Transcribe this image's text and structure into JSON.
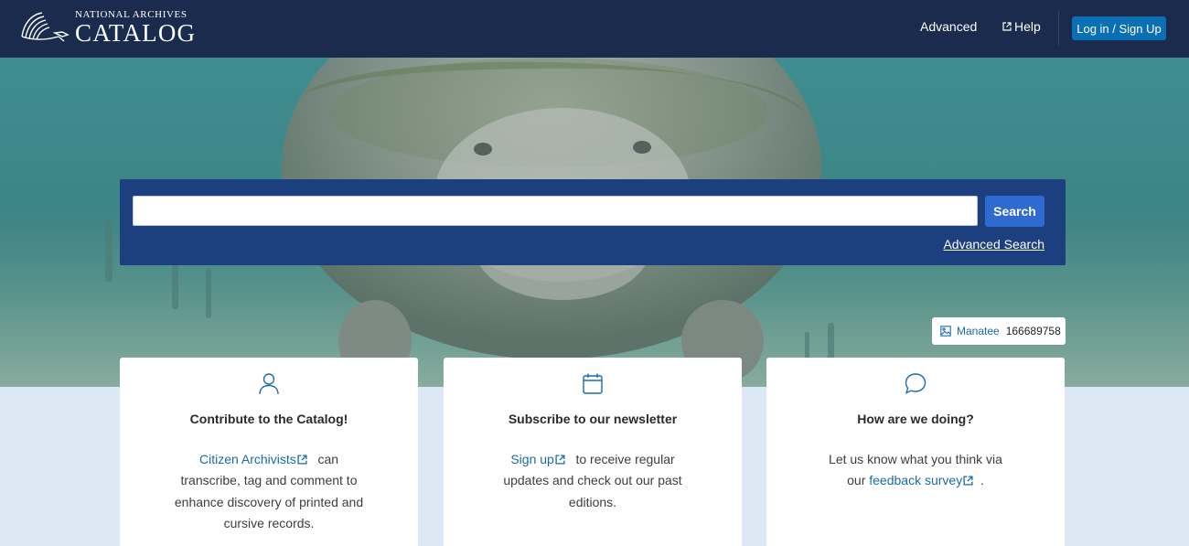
{
  "header": {
    "logo_top": "NATIONAL ARCHIVES",
    "logo_main": "CATALOG",
    "nav_advanced": "Advanced",
    "nav_help": "Help",
    "login_label": "Log in / Sign Up"
  },
  "search": {
    "value": "",
    "placeholder": "",
    "button_label": "Search",
    "advanced_link": "Advanced Search"
  },
  "photo_credit": {
    "title": "Manatee",
    "id": "166689758"
  },
  "cards": [
    {
      "icon": "user-icon",
      "title": "Contribute to the Catalog!",
      "link_text": "Citizen Archivists",
      "line1_after": "can",
      "line2": "transcribe, tag and comment to",
      "line3": "enhance discovery of printed and",
      "line4": "cursive records."
    },
    {
      "icon": "calendar-icon",
      "title": "Subscribe to our newsletter",
      "link_text": "Sign up",
      "line1_after": "to receive regular",
      "line2": "updates and check out our past",
      "line3": "editions."
    },
    {
      "icon": "chat-bubble-icon",
      "title": "How are we doing?",
      "line1": "Let us know what you think via",
      "line2_before": "our",
      "link_text": "feedback survey",
      "line2_after": "."
    }
  ],
  "colors": {
    "header_bg": "#1a2b4e",
    "search_panel_bg": "#1c3f80",
    "search_button": "#2f6ad0",
    "login_button": "#0b6fb4",
    "link": "#1a6ba8",
    "page_bg": "#dce8f4"
  }
}
